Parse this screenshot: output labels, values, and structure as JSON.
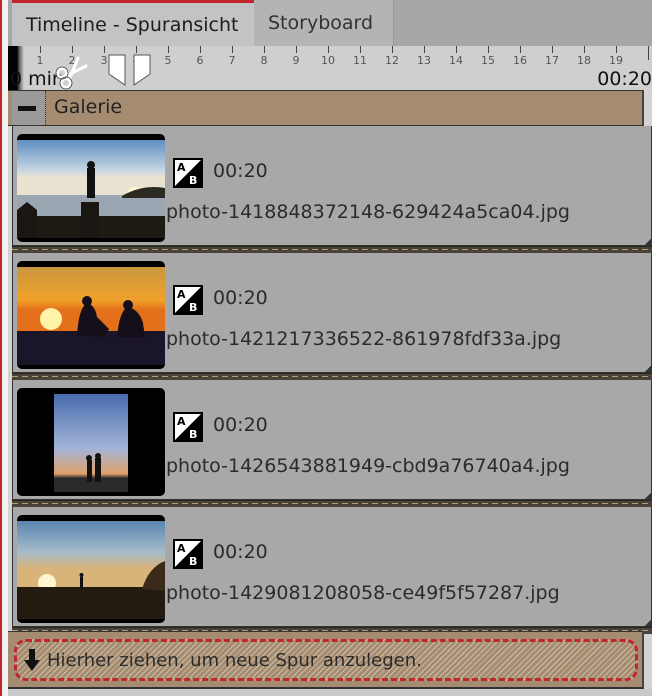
{
  "tabs": [
    {
      "label": "Timeline - Spuransicht",
      "active": true
    },
    {
      "label": "Storyboard",
      "active": false
    }
  ],
  "ruler": {
    "unit_label": "0 min",
    "ticks": [
      "1",
      "2",
      "3",
      "4",
      "5",
      "6",
      "7",
      "8",
      "9",
      "10",
      "11",
      "12",
      "13",
      "14",
      "15",
      "16",
      "17",
      "18",
      "19"
    ],
    "end_time": "00:20"
  },
  "track": {
    "title": "Galerie",
    "collapse_icon": "minus-icon",
    "color": "#a58b70"
  },
  "clips": [
    {
      "transition_icon": "ab-transition-icon",
      "duration": "00:20",
      "filename": "photo-1418848372148-629424a5ca04.jpg",
      "thumbnail": "man-on-rock-at-lake-sunset"
    },
    {
      "transition_icon": "ab-transition-icon",
      "duration": "00:20",
      "filename": "photo-1421217336522-861978fdf33a.jpg",
      "thumbnail": "couple-with-guitar-sunset"
    },
    {
      "transition_icon": "ab-transition-icon",
      "duration": "00:20",
      "filename": "photo-1426543881949-cbd9a76740a4.jpg",
      "thumbnail": "couple-walking-dusk-portrait"
    },
    {
      "transition_icon": "ab-transition-icon",
      "duration": "00:20",
      "filename": "photo-1429081208058-ce49f5f57287.jpg",
      "thumbnail": "person-on-field-sunset"
    }
  ],
  "dropzone": {
    "icon": "arrow-down-icon",
    "text": "Hierher ziehen, um neue Spur anzulegen."
  },
  "colors": {
    "accent": "#c0262b",
    "track": "#a58b70",
    "clip_bg": "#a8a8a8"
  }
}
